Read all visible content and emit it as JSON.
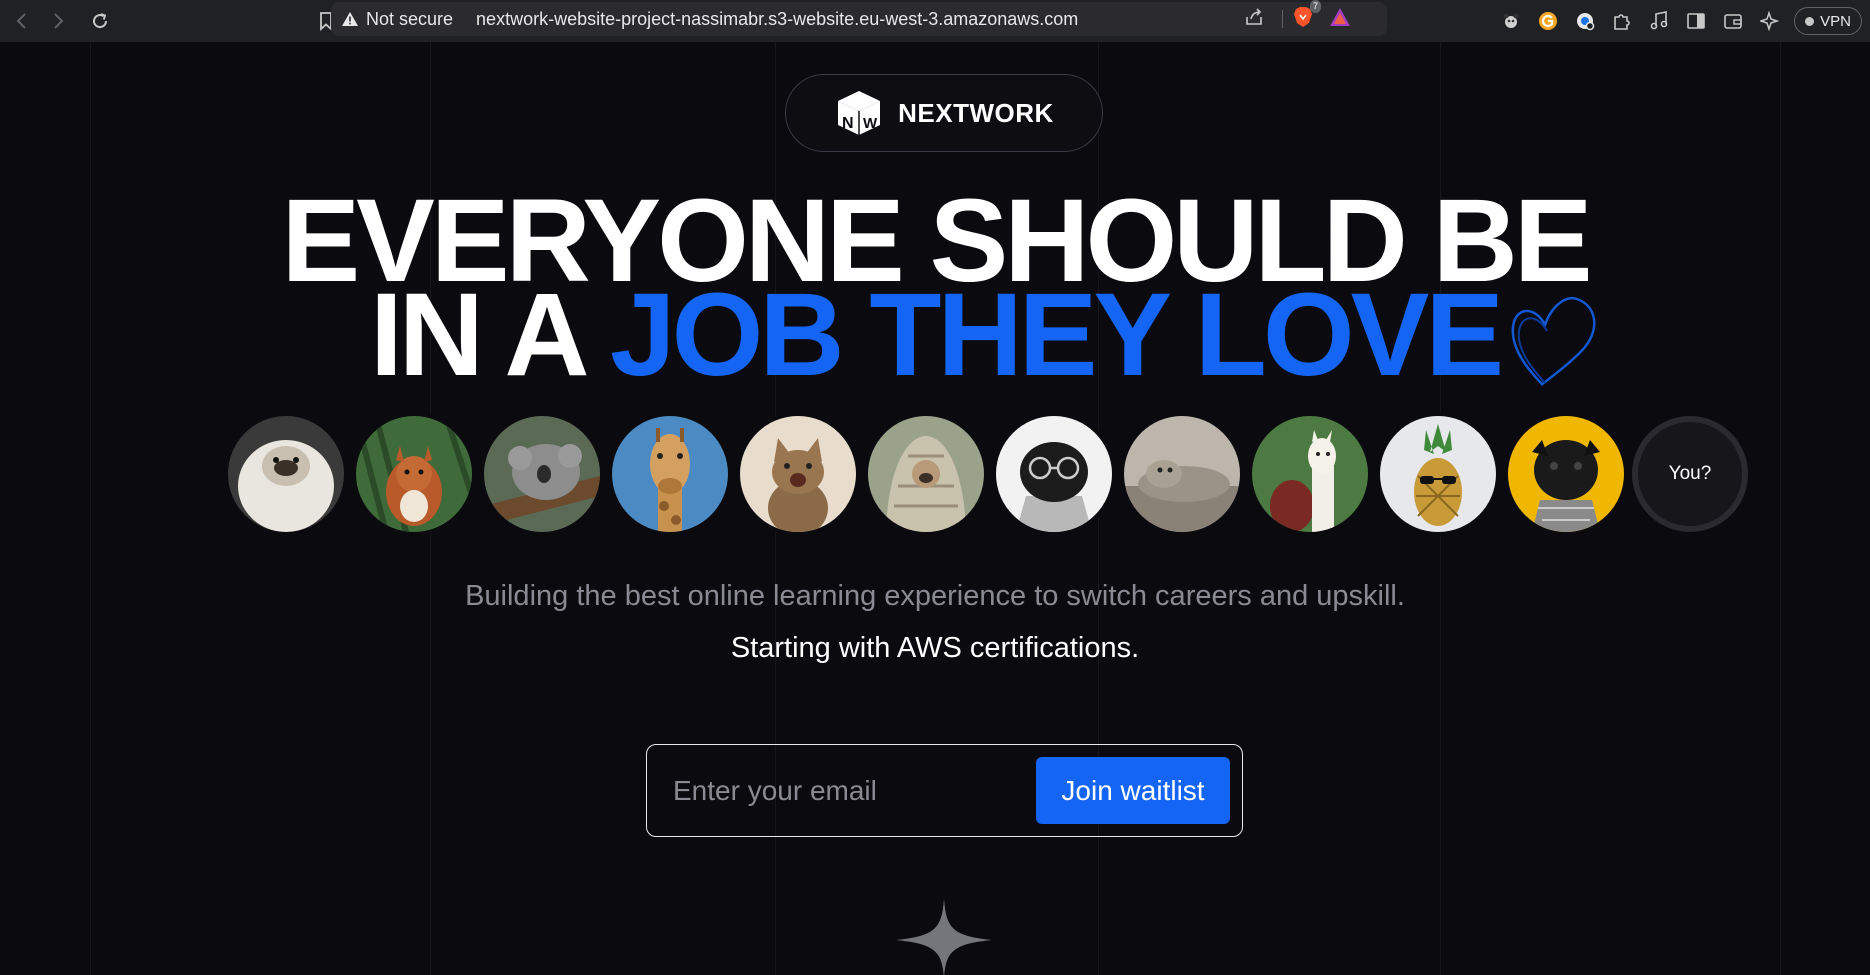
{
  "browser": {
    "security_label": "Not secure",
    "url": "nextwork-website-project-nassimabr.s3-website.eu-west-3.amazonaws.com",
    "brave_badge": "7",
    "vpn_label": "VPN"
  },
  "brand": {
    "name": "NEXTWORK"
  },
  "hero": {
    "line1": "EVERYONE SHOULD BE",
    "line2_prefix": "IN A ",
    "line2_highlight": "JOB THEY LOVE",
    "accent_color": "#1565f5"
  },
  "avatars": {
    "items": [
      {
        "icon": "fluffy-pug-avatar"
      },
      {
        "icon": "squirrel-avatar"
      },
      {
        "icon": "koala-avatar"
      },
      {
        "icon": "giraffe-avatar"
      },
      {
        "icon": "kitten-avatar"
      },
      {
        "icon": "blanket-pug-avatar"
      },
      {
        "icon": "glasses-pug-avatar"
      },
      {
        "icon": "seal-avatar"
      },
      {
        "icon": "alpaca-avatar"
      },
      {
        "icon": "sunglasses-pineapple-avatar"
      },
      {
        "icon": "black-pug-avatar"
      }
    ],
    "you_label": "You?"
  },
  "tagline": {
    "line1": "Building the best online learning experience to switch careers and upskill.",
    "line2": "Starting with AWS certifications."
  },
  "waitlist": {
    "email_placeholder": "Enter your email",
    "button_label": "Join waitlist"
  }
}
